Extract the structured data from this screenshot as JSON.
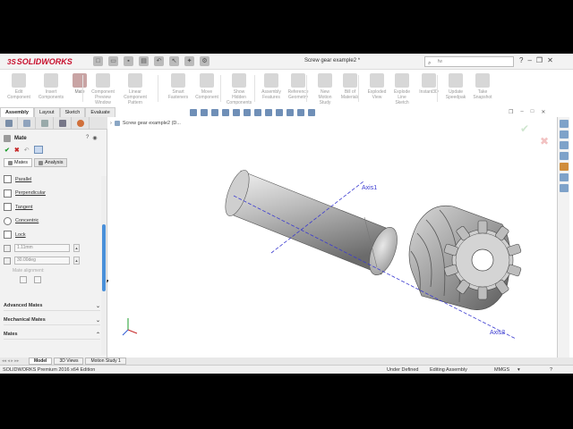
{
  "app": {
    "logo_prefix": "3S",
    "logo": "SOLIDWORKS",
    "doc_title": "Screw gear example2 *",
    "search_placeholder": "fw"
  },
  "ribbon": {
    "tools": [
      {
        "label": "Edit\nComponent",
        "icon": "edit-component-icon"
      },
      {
        "label": "Insert\nComponents",
        "icon": "insert-components-icon"
      },
      {
        "label": "Mate",
        "icon": "mate-icon"
      },
      {
        "label": "Component\nPreview\nWindow",
        "icon": "preview-window-icon"
      },
      {
        "label": "Linear Component\nPattern",
        "icon": "pattern-icon"
      },
      {
        "label": "Smart\nFasteners",
        "icon": "fastener-icon"
      },
      {
        "label": "Move\nComponent",
        "icon": "move-icon"
      },
      {
        "label": "Show\nHidden\nComponents",
        "icon": "show-hidden-icon"
      },
      {
        "label": "Assembly\nFeatures",
        "icon": "assembly-features-icon"
      },
      {
        "label": "Reference\nGeometry",
        "icon": "reference-geometry-icon"
      },
      {
        "label": "New\nMotion\nStudy",
        "icon": "motion-study-icon"
      },
      {
        "label": "Bill of\nMaterials",
        "icon": "bom-icon"
      },
      {
        "label": "Exploded\nView",
        "icon": "exploded-view-icon"
      },
      {
        "label": "Explode\nLine\nSketch",
        "icon": "explode-line-icon"
      },
      {
        "label": "Instant3D",
        "icon": "instant3d-icon"
      },
      {
        "label": "Update\nSpeedpak",
        "icon": "speedpak-icon"
      },
      {
        "label": "Take\nSnapshot",
        "icon": "snapshot-icon"
      }
    ],
    "tabs": [
      "Assembly",
      "Layout",
      "Sketch",
      "Evaluate"
    ]
  },
  "panel": {
    "title": "Mate",
    "subtabs": [
      "Mates",
      "Analysis"
    ],
    "mates": [
      "Parallel",
      "Perpendicular",
      "Tangent",
      "Concentric",
      "Lock"
    ],
    "distance_value": "1.11mm",
    "angle_value": "30.00deg",
    "align_label": "Mate alignment:",
    "sections": [
      "Advanced Mates",
      "Mechanical Mates",
      "Mates"
    ]
  },
  "viewport": {
    "tree_item": "Screw gear example2 (D...",
    "axis1": "Axis1",
    "axis2": "Axis2"
  },
  "bottom_tabs": [
    "Model",
    "3D Views",
    "Motion Study 1"
  ],
  "status": {
    "product": "SOLIDWORKS Premium 2016 x64 Edition",
    "state": "Under Defined",
    "mode": "Editing Assembly",
    "units": "MMGS"
  },
  "colors": {
    "accent": "#c8102e",
    "scroll": "#4a90d9",
    "axis": "#3a3ad0"
  }
}
